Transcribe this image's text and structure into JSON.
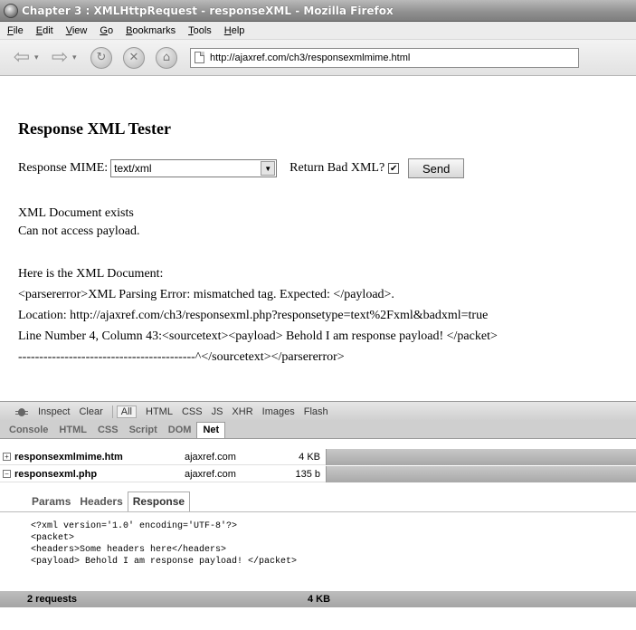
{
  "window": {
    "title": "Chapter 3 : XMLHttpRequest - responseXML - Mozilla Firefox"
  },
  "menu": [
    "File",
    "Edit",
    "View",
    "Go",
    "Bookmarks",
    "Tools",
    "Help"
  ],
  "toolbar": {
    "back_icon": "back-arrow-icon",
    "forward_icon": "forward-arrow-icon",
    "url": "http://ajaxref.com/ch3/responsexmlmime.html"
  },
  "page": {
    "heading": "Response XML Tester",
    "mime_label": "Response MIME:",
    "mime_value": "text/xml",
    "bad_xml_label": "Return Bad XML?",
    "bad_xml_checked": "✔",
    "send_label": "Send",
    "lines": [
      "XML Document exists",
      "Can not access payload.",
      "Here is the XML Document:",
      "<parsererror>XML Parsing Error: mismatched tag. Expected: </payload>.",
      "Location: http://ajaxref.com/ch3/responsexml.php?responsetype=text%2Fxml&badxml=true",
      "Line Number 4, Column 43:<sourcetext><payload> Behold I am response payload! </packet>",
      "------------------------------------------^</sourcetext></parsererror>"
    ]
  },
  "firebug": {
    "toolbar": [
      "Inspect",
      "Clear",
      "All",
      "HTML",
      "CSS",
      "JS",
      "XHR",
      "Images",
      "Flash"
    ],
    "tabs": [
      "Console",
      "HTML",
      "CSS",
      "Script",
      "DOM",
      "Net"
    ],
    "requests": [
      {
        "file": "responsexmlmime.htm",
        "domain": "ajaxref.com",
        "size": "4 KB",
        "toggle": "+"
      },
      {
        "file": "responsexml.php",
        "domain": "ajaxref.com",
        "size": "135 b",
        "toggle": "−"
      }
    ],
    "detail_tabs": [
      "Params",
      "Headers",
      "Response"
    ],
    "response_body": [
      "<?xml version='1.0' encoding='UTF-8'?>",
      "<packet>",
      "<headers>Some headers here</headers>",
      "<payload> Behold I am response payload! </packet>"
    ],
    "status": {
      "count": "2 requests",
      "total": "4 KB"
    }
  }
}
